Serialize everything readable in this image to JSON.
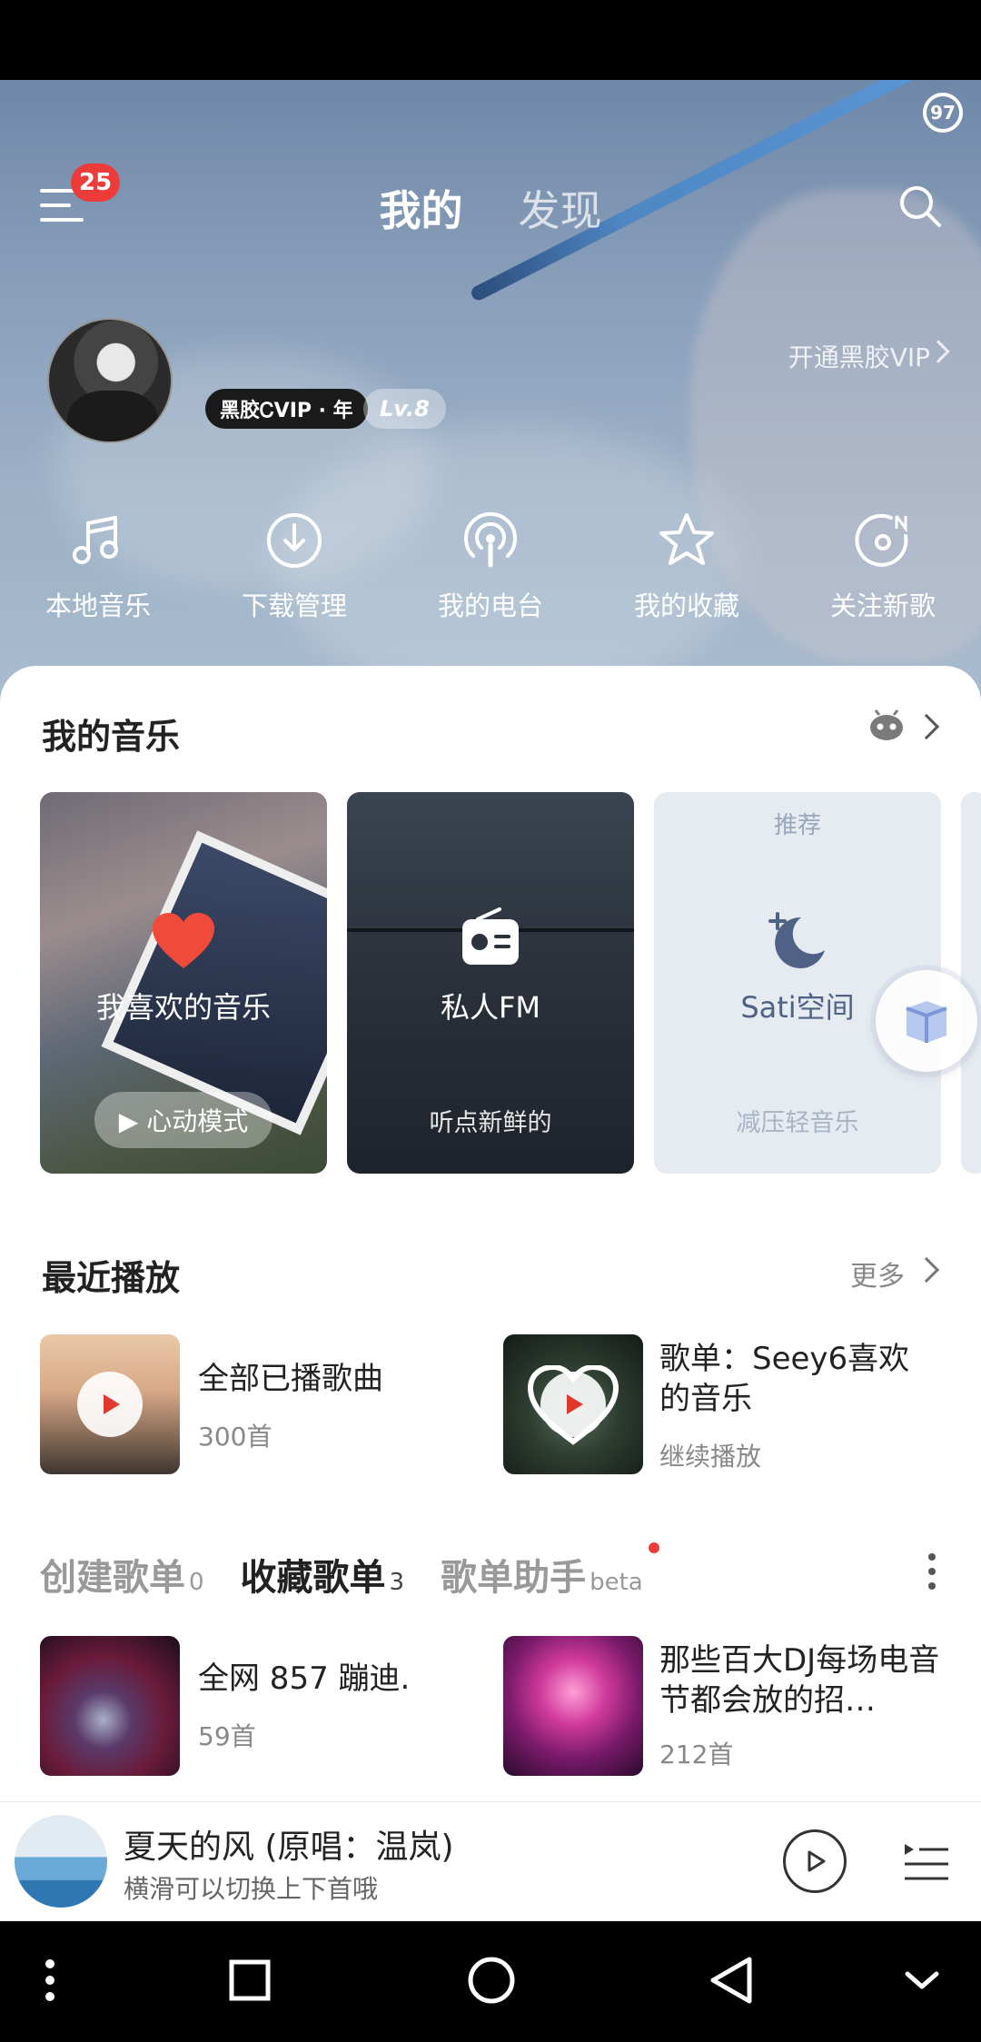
{
  "status": {
    "badge": "97"
  },
  "header": {
    "menu_badge": "25",
    "tabs": [
      {
        "label": "我的"
      },
      {
        "label": "发现"
      }
    ]
  },
  "profile": {
    "vip_badge": "黑胶ᏟVIP · 年",
    "level": "Lv.8",
    "open_vip": "开通黑胶VIP"
  },
  "quick_actions": [
    {
      "label": "本地音乐",
      "icon": "music-note-icon"
    },
    {
      "label": "下载管理",
      "icon": "download-icon"
    },
    {
      "label": "我的电台",
      "icon": "radio-podcast-icon"
    },
    {
      "label": "我的收藏",
      "icon": "star-icon"
    },
    {
      "label": "关注新歌",
      "icon": "new-song-icon"
    }
  ],
  "my_music": {
    "title": "我的音乐",
    "cards": [
      {
        "label": "我喜欢的音乐",
        "button": "▶ 心动模式"
      },
      {
        "label": "私人FM",
        "caption": "听点新鲜的"
      },
      {
        "tag": "推荐",
        "label": "Sati空间",
        "caption": "减压轻音乐"
      }
    ]
  },
  "recent": {
    "title": "最近播放",
    "more": "更多",
    "items": [
      {
        "title": "全部已播歌曲",
        "sub": "300首"
      },
      {
        "title": "歌单：Seey6喜欢的音乐",
        "sub": "继续播放"
      }
    ]
  },
  "playlists": {
    "tabs": [
      {
        "label": "创建歌单",
        "count": "0"
      },
      {
        "label": "收藏歌单",
        "count": "3"
      },
      {
        "label": "歌单助手",
        "count": "beta"
      }
    ],
    "items": [
      {
        "title": "全网 857 蹦迪.",
        "sub": "59首"
      },
      {
        "title": "那些百大DJ每场电音节都会放的招…",
        "sub": "212首"
      }
    ]
  },
  "player": {
    "title": "夏天的风 (原唱：温岚)",
    "subtitle": "横滑可以切换上下首哦"
  },
  "colors": {
    "accent_red": "#ec3b3b",
    "hero_blue": "#8aa0bb"
  }
}
